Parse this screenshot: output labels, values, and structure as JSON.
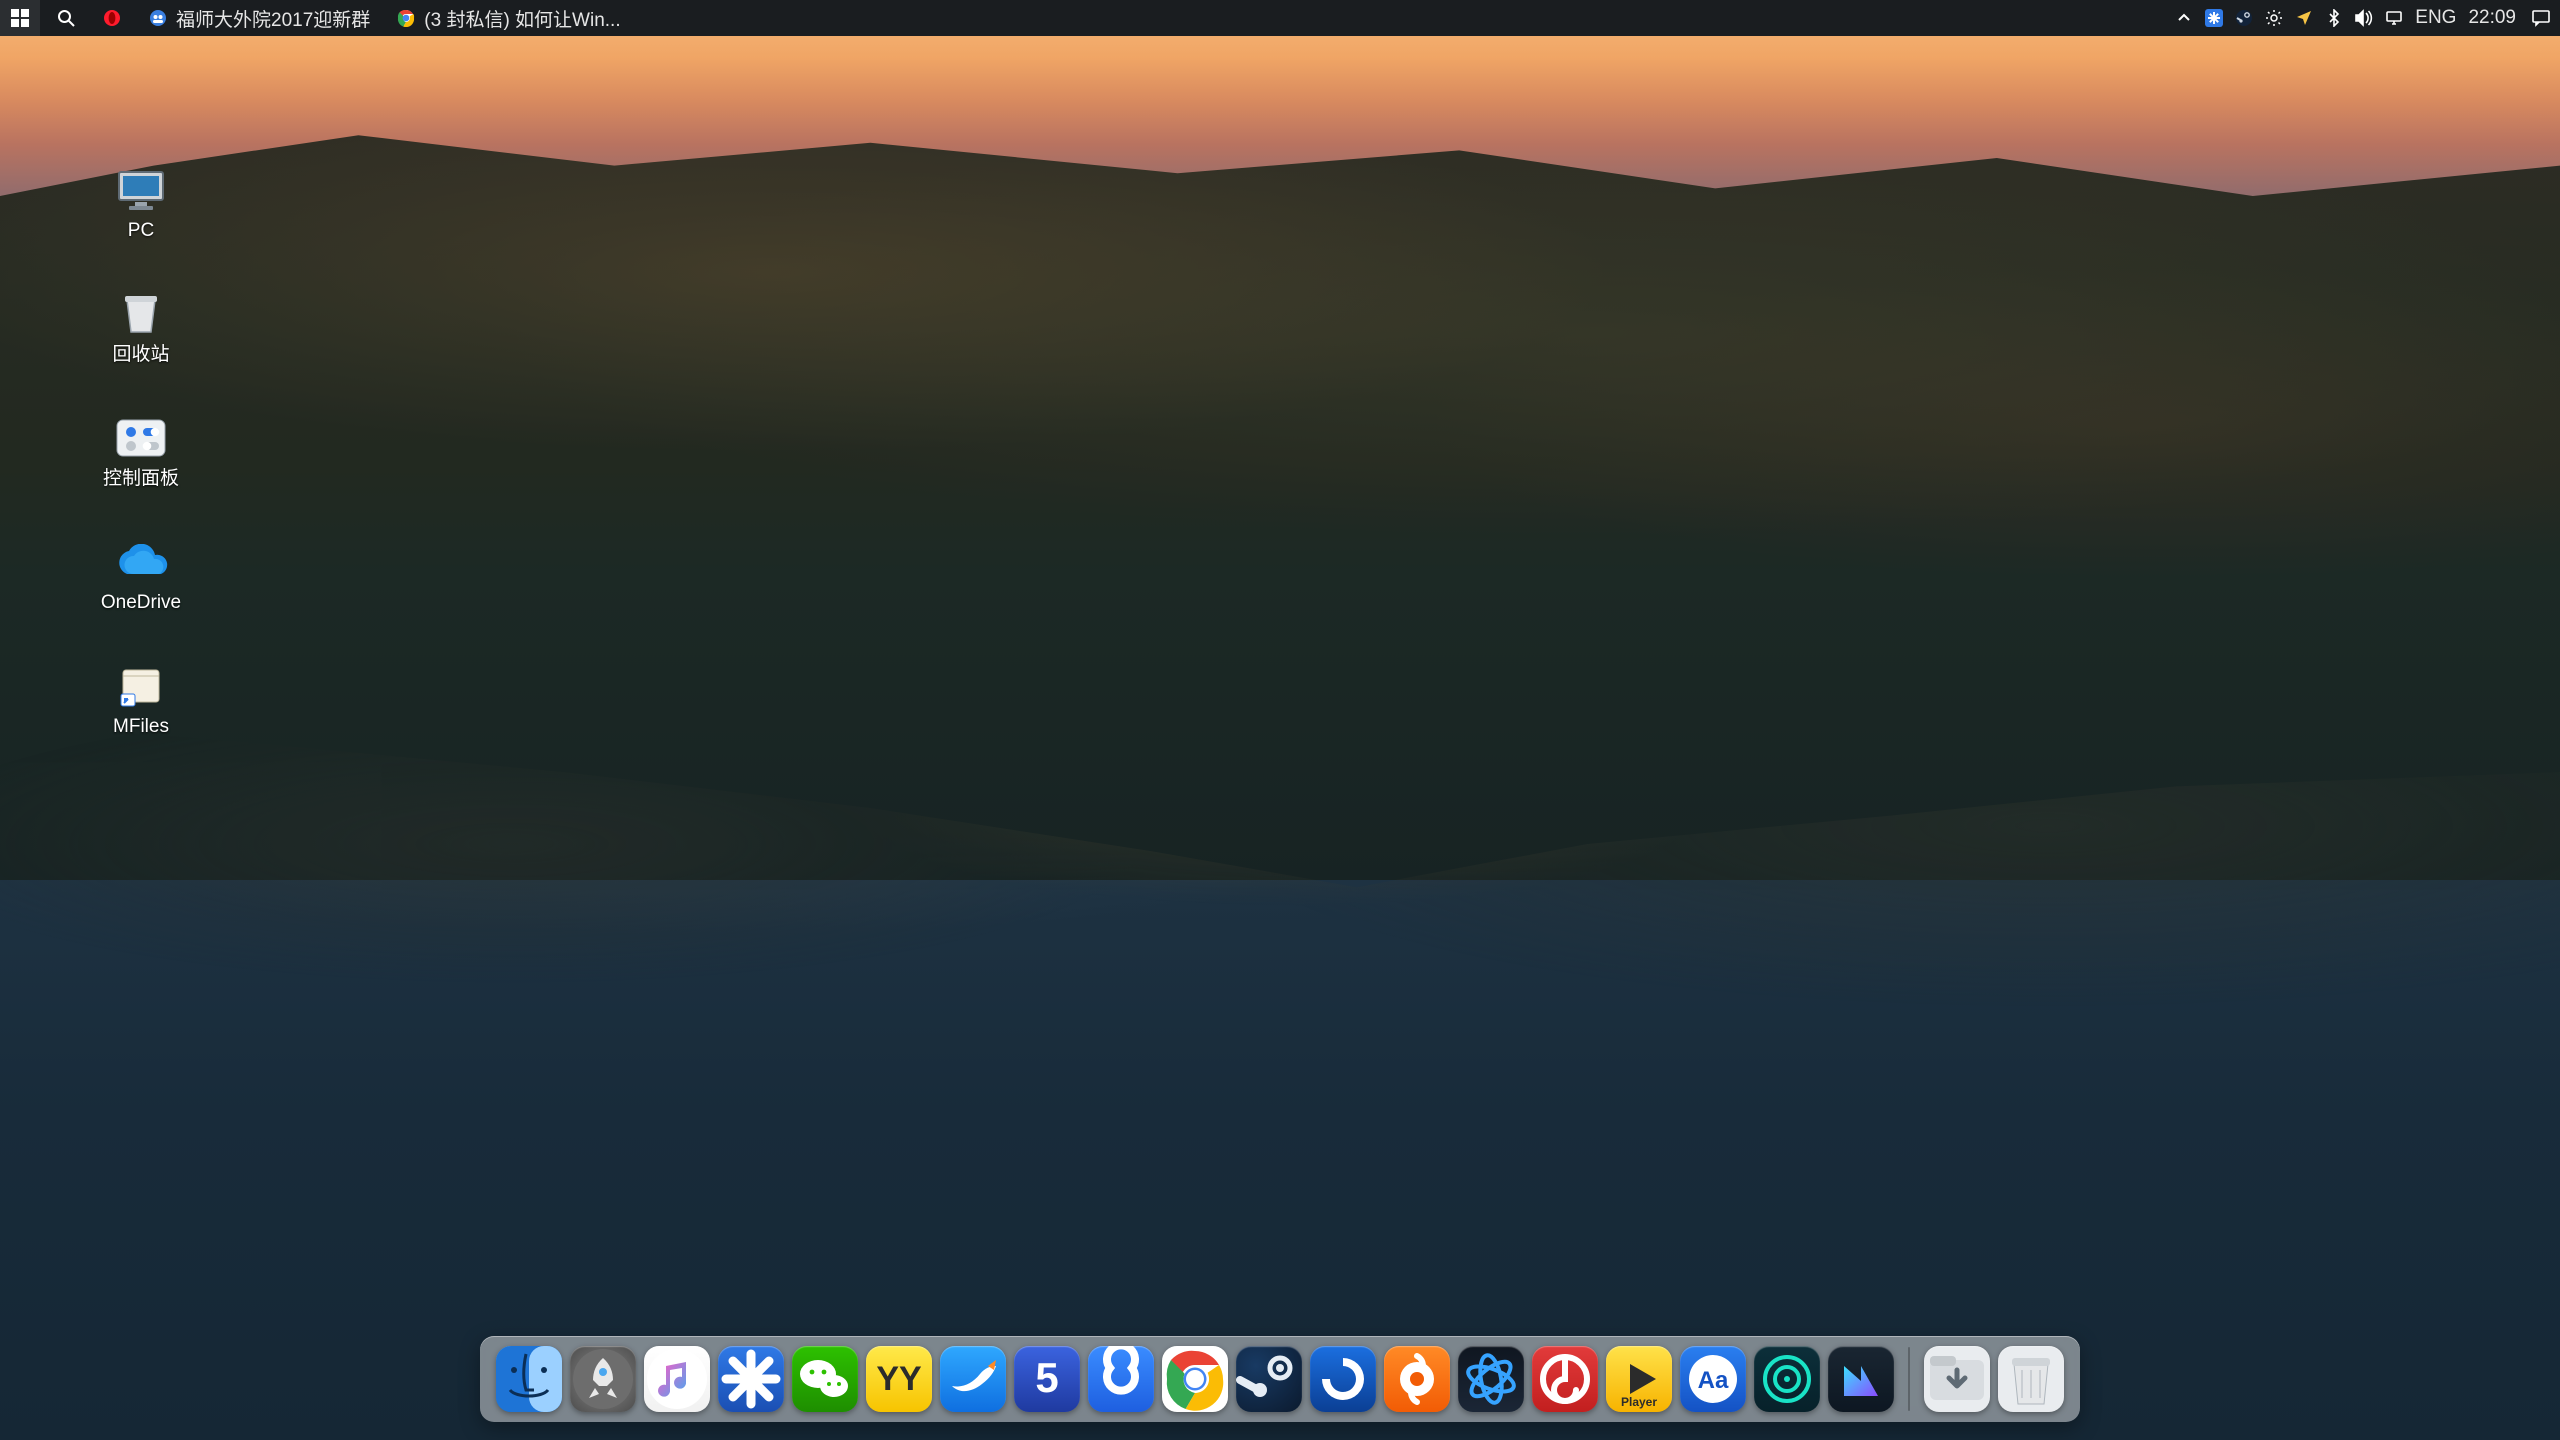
{
  "taskbar": {
    "apps": [
      {
        "id": "start",
        "label": ""
      },
      {
        "id": "search",
        "label": ""
      },
      {
        "id": "opera",
        "label": ""
      },
      {
        "id": "qq-group",
        "label": "福师大外院2017迎新群"
      },
      {
        "id": "chrome",
        "label": "(3 封私信) 如何让Win..."
      }
    ],
    "tray": {
      "language": "ENG",
      "clock": "22:09"
    }
  },
  "desktop": {
    "icons": [
      {
        "id": "pc",
        "label": "PC"
      },
      {
        "id": "recycle-bin",
        "label": "回收站"
      },
      {
        "id": "control-panel",
        "label": "控制面板"
      },
      {
        "id": "onedrive",
        "label": "OneDrive"
      },
      {
        "id": "mfiles",
        "label": "MFiles"
      }
    ]
  },
  "dock": {
    "items": [
      {
        "id": "finder",
        "bg": "linear-gradient(#4aa7ef,#0b5fb5)",
        "glyph": "finder"
      },
      {
        "id": "launchpad",
        "bg": "radial-gradient(circle,#8c8c8c,#4b4b4b)",
        "glyph": "rocket"
      },
      {
        "id": "music",
        "bg": "linear-gradient(#fff,#f1f1f1)",
        "glyph": "music"
      },
      {
        "id": "tim",
        "bg": "linear-gradient(#2f79e6,#1b4fb3)",
        "glyph": "asterisk"
      },
      {
        "id": "wechat",
        "bg": "linear-gradient(#2dc100,#1e8e00)",
        "glyph": "wechat"
      },
      {
        "id": "yy",
        "bg": "linear-gradient(#ffe94a,#f7c400)",
        "glyph": "yy"
      },
      {
        "id": "thunder",
        "bg": "linear-gradient(#2fa8ff,#0f6fe0)",
        "glyph": "bird"
      },
      {
        "id": "five",
        "bg": "linear-gradient(#3b63df,#1f3aa0)",
        "glyph": "five"
      },
      {
        "id": "baidu-pan",
        "bg": "linear-gradient(#3a8cff,#1e5fe0)",
        "glyph": "loop"
      },
      {
        "id": "chrome",
        "bg": "#fff",
        "glyph": "chrome"
      },
      {
        "id": "steam",
        "bg": "radial-gradient(circle at 30% 30%,#183a63,#0b1a2e)",
        "glyph": "steam"
      },
      {
        "id": "uplay",
        "bg": "linear-gradient(#1b6fe0,#0b3f94)",
        "glyph": "swirl"
      },
      {
        "id": "origin",
        "bg": "linear-gradient(#ff8a26,#f25c05)",
        "glyph": "origin"
      },
      {
        "id": "battlenet",
        "bg": "linear-gradient(#0f1620,#1b2636)",
        "glyph": "bnet"
      },
      {
        "id": "netease",
        "bg": "linear-gradient(#e23b3b,#c21f1f)",
        "glyph": "netease"
      },
      {
        "id": "potplayer",
        "bg": "linear-gradient(#ffe24a,#f7b300)",
        "glyph": "play",
        "caption": "Player"
      },
      {
        "id": "eudic",
        "bg": "linear-gradient(#2a7ff0,#1452c4)",
        "glyph": "aa"
      },
      {
        "id": "target",
        "bg": "linear-gradient(#0c2f3a,#07212a)",
        "glyph": "target"
      },
      {
        "id": "filmora",
        "bg": "linear-gradient(#1a2632,#0d1722)",
        "glyph": "filmora"
      }
    ],
    "extras": [
      {
        "id": "downloads",
        "glyph": "downloads"
      },
      {
        "id": "trash",
        "glyph": "trash"
      }
    ]
  }
}
